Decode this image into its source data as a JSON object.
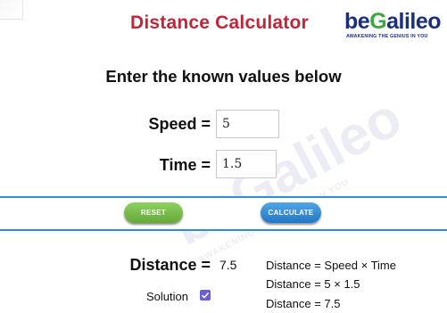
{
  "header": {
    "title": "Distance Calculator",
    "logo": {
      "wordmark_pre": "be",
      "wordmark_g": "G",
      "wordmark_post": "alileo",
      "tagline": "AWAKENING THE GENIUS IN YOU"
    }
  },
  "form": {
    "instruction": "Enter the known values below",
    "speed": {
      "label": "Speed =",
      "value": "5"
    },
    "time": {
      "label": "Time =",
      "value": "1.5"
    }
  },
  "buttons": {
    "reset": "RESET",
    "calculate": "CALCULATE"
  },
  "result": {
    "label": "Distance =",
    "value": "7.5"
  },
  "solution": {
    "label": "Solution",
    "checked": true,
    "steps": [
      "Distance = Speed × Time",
      "Distance = 5 × 1.5",
      "Distance = 7.5"
    ]
  },
  "colors": {
    "title": "#c0263a",
    "brand_blue": "#1b2f7a",
    "brand_green": "#3aa83d",
    "band_border": "#2d8fd6",
    "reset_button": "#6fb843",
    "calculate_button": "#2f86d3",
    "checkbox": "#6c5dd3"
  }
}
